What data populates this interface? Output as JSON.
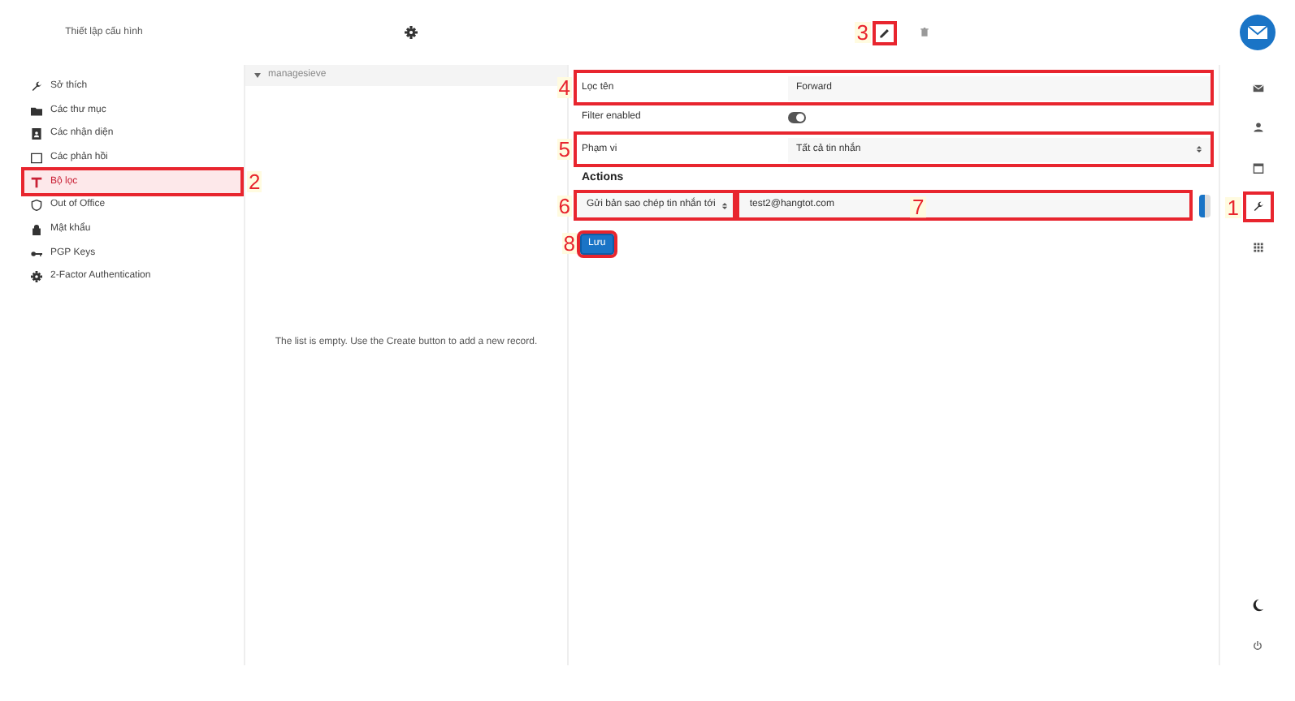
{
  "header": {
    "title": "Thiết lập cấu hình"
  },
  "settings_menu": [
    {
      "label": "Sở thích",
      "selected": false
    },
    {
      "label": "Các thư mục",
      "selected": false
    },
    {
      "label": "Các nhận diện",
      "selected": false
    },
    {
      "label": "Các phản hồi",
      "selected": false
    },
    {
      "label": "Bộ lọc",
      "selected": true,
      "callout": "2"
    },
    {
      "label": "Out of Office",
      "selected": false
    },
    {
      "label": "Mật khẩu",
      "selected": false
    },
    {
      "label": "PGP Keys",
      "selected": false
    },
    {
      "label": "2-Factor Authentication",
      "selected": false
    }
  ],
  "filter_sets": {
    "title": "managesieve",
    "expanded": true,
    "empty_message": "The list is empty. Use the Create button to add a new record."
  },
  "toolbar": {
    "edit_callout": "3"
  },
  "form": {
    "name_label": "Lọc tên",
    "name_value": "Forward",
    "name_callout": "4",
    "enabled_label": "Filter enabled",
    "enabled": true,
    "scope_label": "Phạm vi",
    "scope_value": "Tất cả tin nhắn",
    "scope_callout": "5",
    "actions_title": "Actions",
    "action_value": "Gửi bản sao chép tin nhắn tới",
    "action_callout": "6",
    "target_value": "test2@hangtot.com",
    "target_callout": "7",
    "save_label": "Lưu",
    "save_callout": "8"
  },
  "app_nav": {
    "settings_callout": "1"
  }
}
